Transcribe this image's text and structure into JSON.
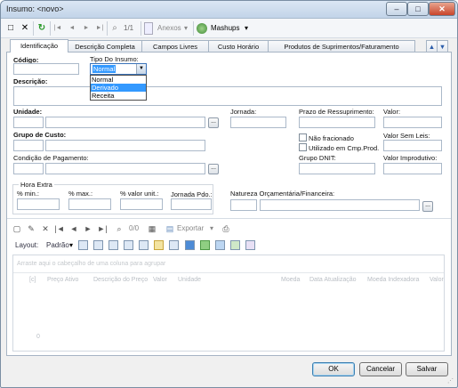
{
  "window": {
    "title": "Insumo: <novo>",
    "min": "‒",
    "max": "□",
    "close": "✕"
  },
  "toolbar": {
    "new_icon": "□",
    "delete_icon": "✕",
    "refresh_icon": "↻",
    "first_icon": "|◄",
    "prev_icon": "◄",
    "next_icon": "►",
    "last_icon": "►|",
    "search_icon": "⌕",
    "page": "1/1",
    "attach_label": "Anexos",
    "mashups_label": "Mashups",
    "dropdown_arrow": "▾"
  },
  "tabs": [
    "Identificação",
    "Descrição Completa",
    "Campos Livres",
    "Custo Horário",
    "Produtos de Suprimentos/Faturamento"
  ],
  "tab_scroll": {
    "up": "▲",
    "down": "▼"
  },
  "form": {
    "codigo_label": "Código:",
    "tipo_label": "Tipo Do Insumo:",
    "tipo_value": "Normal",
    "tipo_options": [
      "Normal",
      "Derivado",
      "Receita"
    ],
    "descricao_label": "Descrição:",
    "unidade_label": "Unidade:",
    "jornada_label": "Jornada:",
    "prazo_label": "Prazo de Ressuprimento:",
    "valor_label": "Valor:",
    "grupo_label": "Grupo de Custo:",
    "nao_fracionado_label": "Não fracionado",
    "utilizado_label": "Utilizado em Cmp.Prod.",
    "valor_sem_leis_label": "Valor Sem Leis:",
    "condicao_label": "Condição de Pagamento:",
    "grupo_dnit_label": "Grupo DNIT:",
    "valor_improdutivo_label": "Valor Improdutivo:",
    "hora_extra_label": "Hora Extra",
    "pct_min_label": "% min.:",
    "pct_max_label": "% max.:",
    "pct_valor_label": "% valor unit.:",
    "jornada_pdo_label": "Jornada Pdo.:",
    "natureza_label": "Natureza Orçamentária/Financeira:",
    "dots": "..."
  },
  "grid_toolbar": {
    "page": "0/0",
    "export_label": "Exportar",
    "layout_label": "Layout:",
    "padrao_label": "Padrão",
    "dropdown_arrow": "▾"
  },
  "grid": {
    "group_hint": "Arraste aqui o cabeçalho de uma coluna para agrupar",
    "columns": [
      "[c]",
      "Preço Ativo",
      "Descrição do Preço",
      "Valor",
      "Unidade",
      "Moeda",
      "Data Atualização",
      "Moeda Indexadora",
      "Valor"
    ],
    "footer_value": "0"
  },
  "buttons": {
    "ok": "OK",
    "cancel": "Cancelar",
    "save": "Salvar"
  }
}
